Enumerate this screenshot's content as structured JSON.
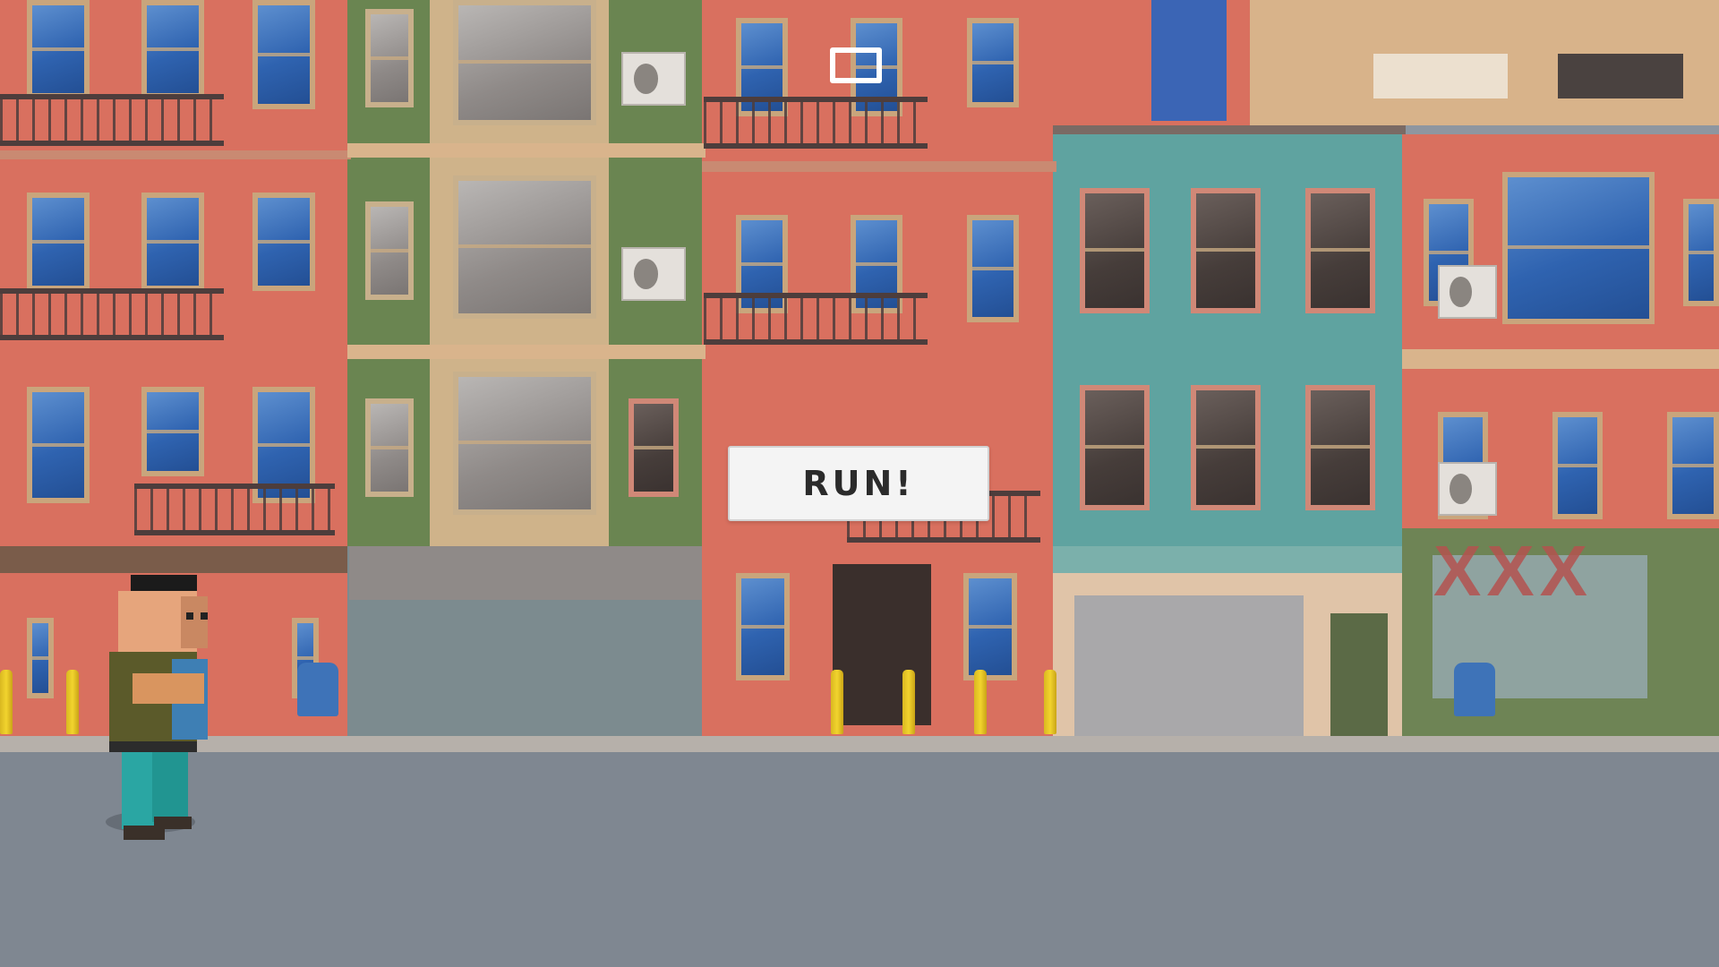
{
  "game": {
    "run_button_label": "RUN!",
    "store_sign_text": "XXX"
  },
  "icons": {
    "top_indicator": "window-outline-icon",
    "player": "voxel-player-character"
  },
  "colors": {
    "sky_building_red": "#d9705f",
    "teal_building": "#5fa3a0",
    "green_building": "#5f7a4a",
    "road": "#8e96a0",
    "bollard_yellow": "#f2d42e"
  }
}
